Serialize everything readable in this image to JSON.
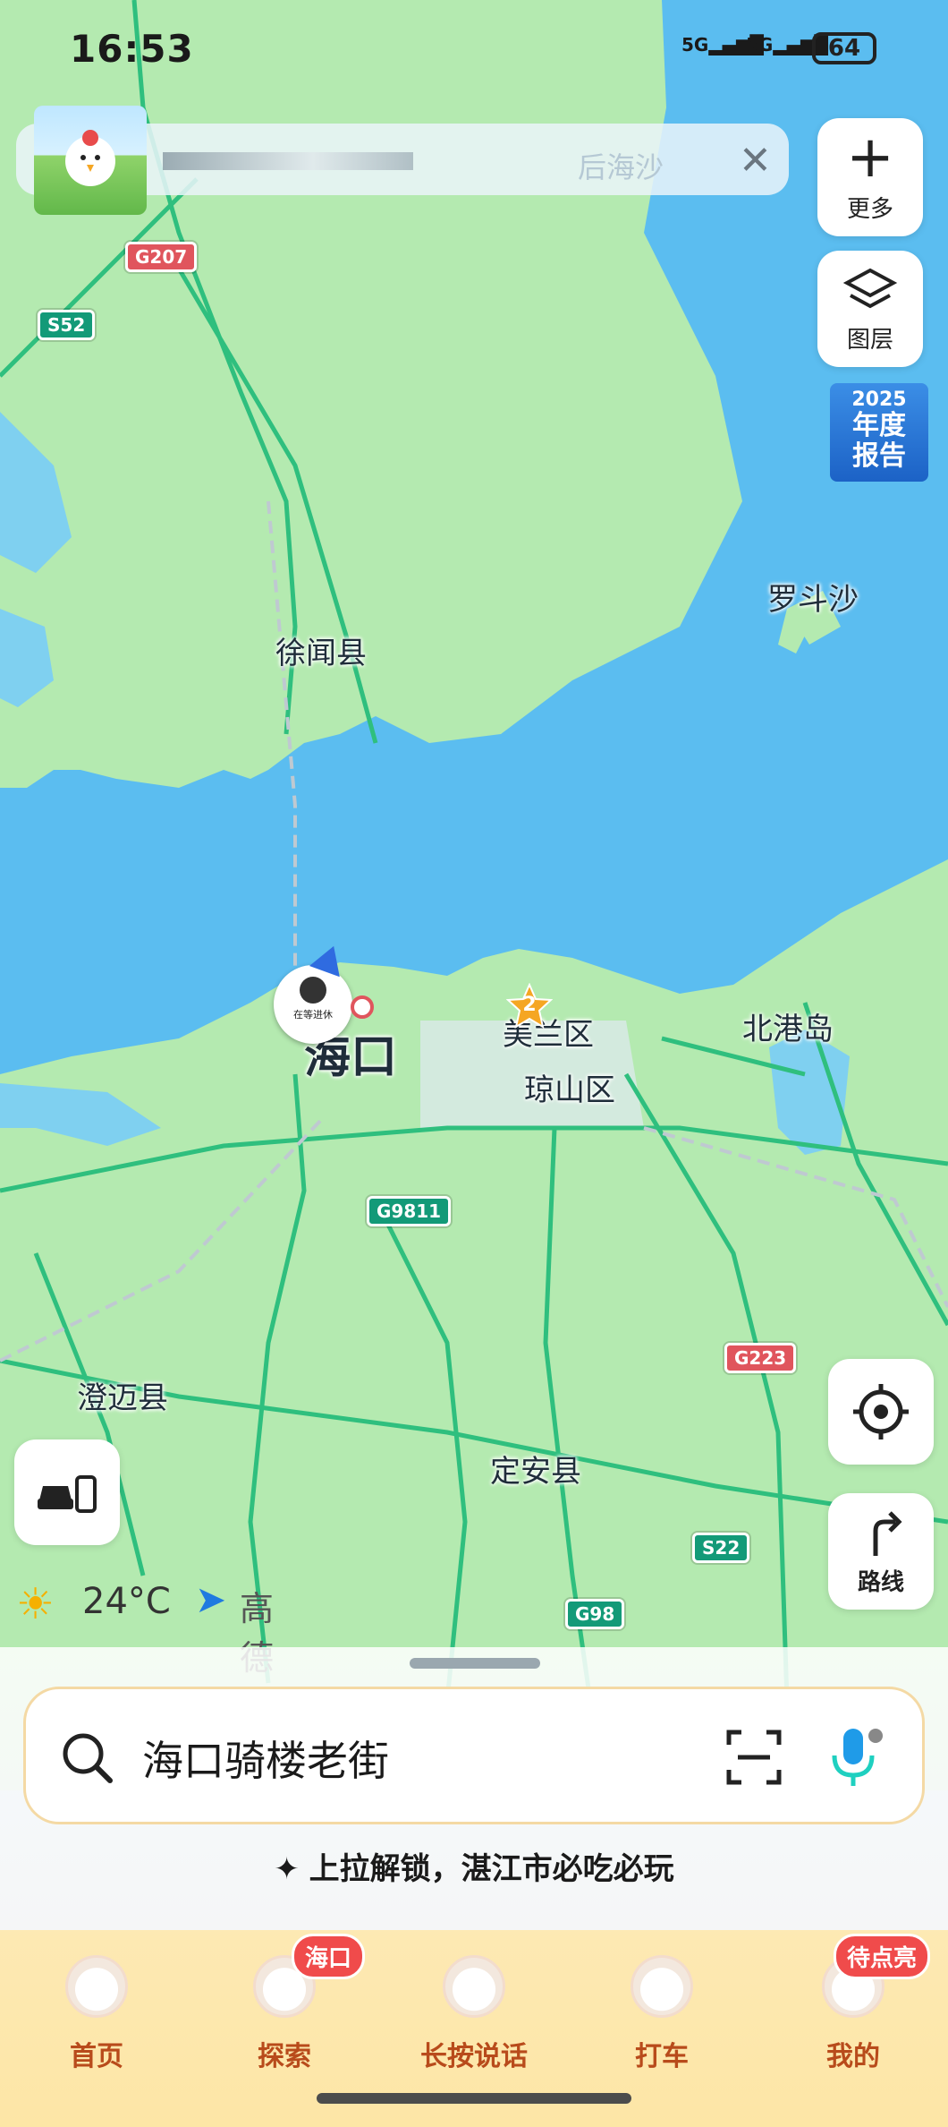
{
  "status_bar": {
    "time": "16:53",
    "signal_1": "5G",
    "signal_2": "5G",
    "battery": "64"
  },
  "banner": {
    "place": "后海沙",
    "close_icon": "close-icon"
  },
  "right_buttons": {
    "more_label": "更多",
    "layers_label": "图层",
    "report_year": "2025",
    "report_line1": "年度",
    "report_line2": "报告",
    "route_label": "路线"
  },
  "map_labels": {
    "xuwen": "徐闻县",
    "luodousha": "罗斗沙",
    "haikou": "海口",
    "meilan": "美兰区",
    "qiongshan": "琼山区",
    "beigang": "北港岛",
    "chengmai": "澄迈县",
    "dingan": "定安县",
    "marker_count": "2",
    "avatar_caption": "在等进休"
  },
  "road_shields": {
    "g207": "G207",
    "s52": "S52",
    "g9811": "G9811",
    "g223": "G223",
    "s22": "S22",
    "g98": "G98"
  },
  "weather": {
    "temp": "24°C",
    "brand": "高德地图"
  },
  "search": {
    "query": "海口骑楼老街"
  },
  "promo": {
    "text": "上拉解锁，湛江市必吃必玩"
  },
  "tabs": [
    {
      "label": "首页",
      "badge": ""
    },
    {
      "label": "探索",
      "badge": "海口"
    },
    {
      "label": "长按说话",
      "badge": ""
    },
    {
      "label": "打车",
      "badge": ""
    },
    {
      "label": "我的",
      "badge": "待点亮"
    }
  ],
  "colors": {
    "sea": "#5bbdf0",
    "land": "#b4eab0",
    "road": "#2fbf7e",
    "tab_text": "#b84b1b",
    "badge": "#f04b4b"
  }
}
